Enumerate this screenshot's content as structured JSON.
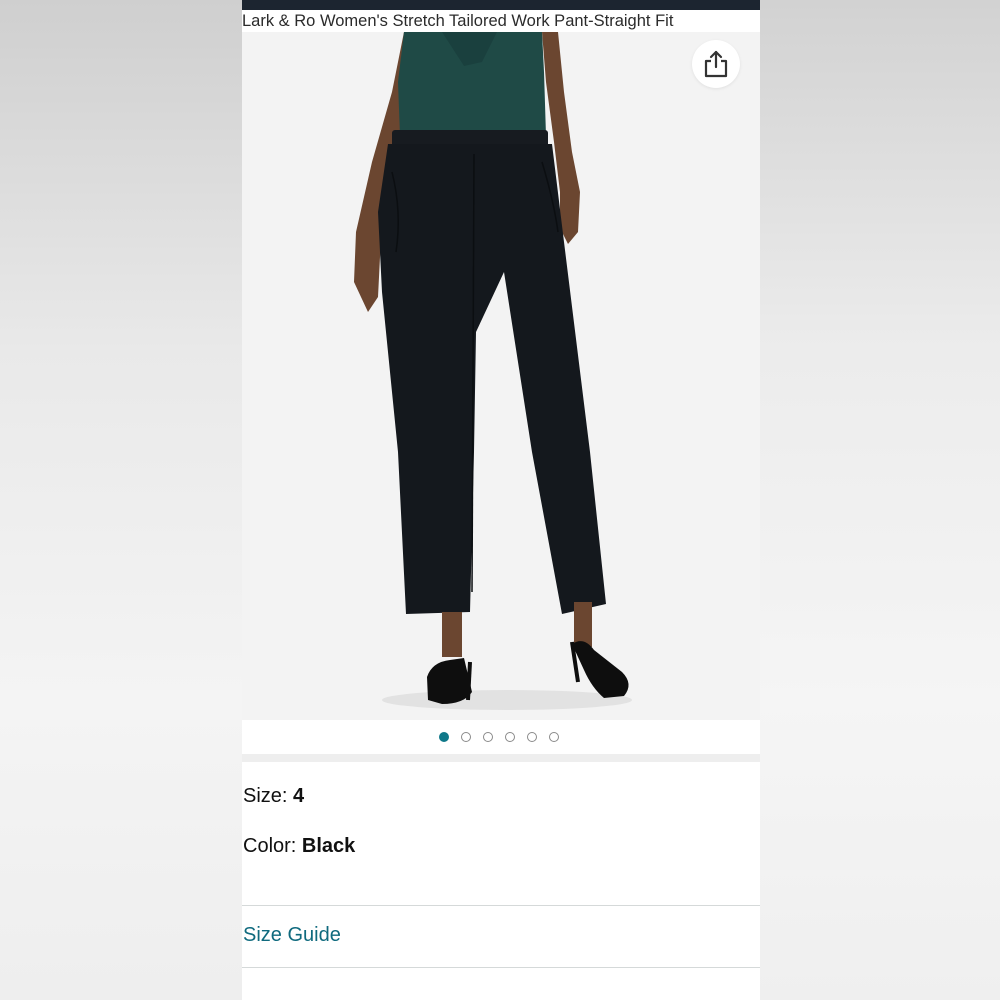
{
  "product": {
    "title": "Lark & Ro Women's Stretch Tailored Work Pant-Straight Fit"
  },
  "gallery": {
    "image_count": 6,
    "active_index": 0,
    "accent_color": "#0f7889"
  },
  "details": {
    "size_label": "Size:",
    "size_value": "4",
    "color_label": "Color:",
    "color_value": "Black"
  },
  "links": {
    "size_guide": "Size Guide"
  },
  "icons": {
    "share": "share-icon"
  },
  "colors": {
    "top_bar": "#1c2530",
    "link": "#0f6a7e",
    "pants": "#14181d",
    "blouse": "#1f4a46"
  }
}
